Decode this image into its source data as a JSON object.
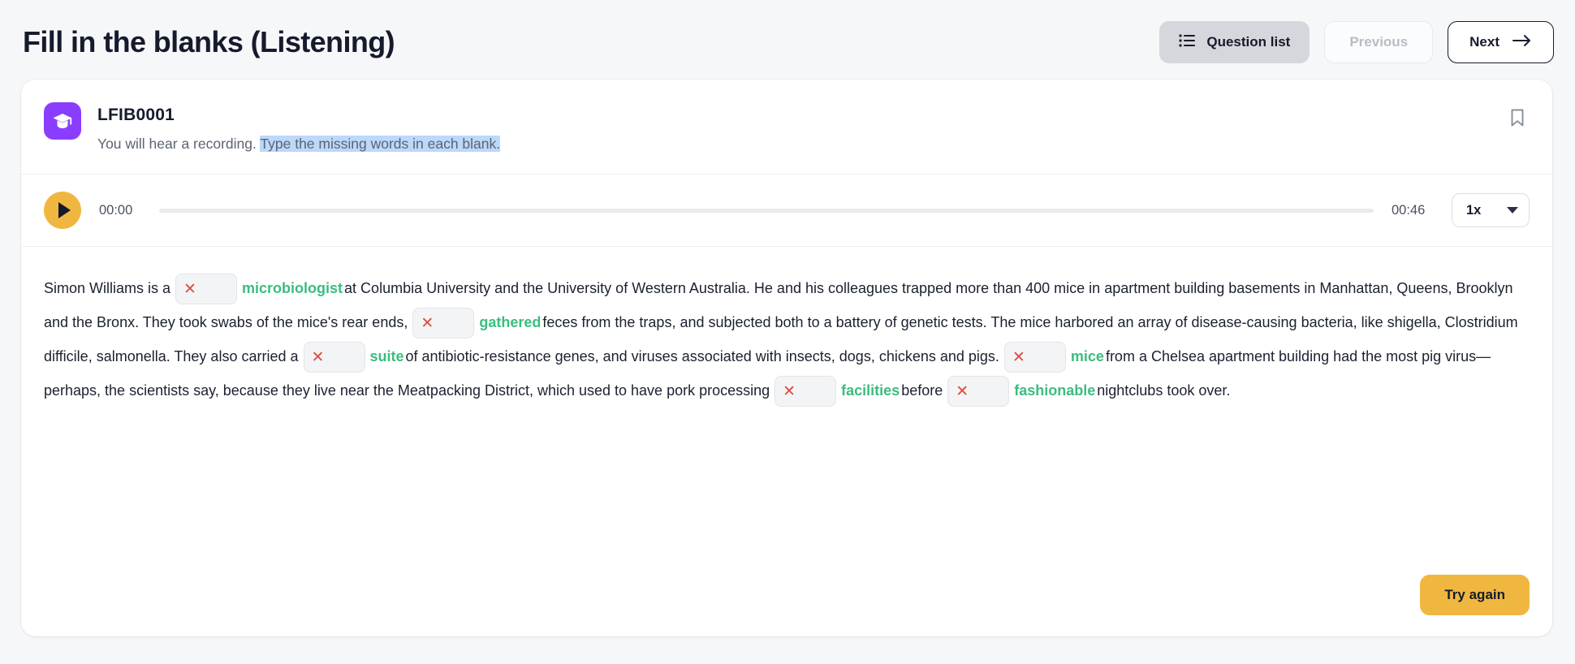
{
  "header": {
    "title": "Fill in the blanks (Listening)",
    "question_list_label": "Question list",
    "previous_label": "Previous",
    "next_label": "Next"
  },
  "question": {
    "code": "LFIB0001",
    "instruction_plain": "You will hear a recording.",
    "instruction_highlighted": "Type the missing words in each blank."
  },
  "player": {
    "current_time": "00:00",
    "duration": "00:46",
    "speed": "1x",
    "progress_percent": 0
  },
  "passage": {
    "s1": "Simon Williams is a",
    "a1": "microbiologist",
    "s2": "at Columbia University and the University of Western Australia. He and his colleagues trapped more than 400 mice in apartment building basements in Manhattan, Queens, Brooklyn and the Bronx. They took swabs of the mice's rear ends,",
    "a2": "gathered",
    "s3": "feces from the traps, and subjected both to a battery of genetic tests. The mice harbored an array of disease-causing bacteria, like shigella, Clostridium difficile, salmonella. They also carried a",
    "a3": "suite",
    "s4": "of antibiotic-resistance genes, and viruses associated with insects, dogs, chickens and pigs.",
    "a4": "mice",
    "s5": "from a Chelsea apartment building had the most pig virus—perhaps, the scientists say, because they live near the Meatpacking District, which used to have pork processing",
    "a5": "facilities",
    "s6": "before",
    "a6": "fashionable",
    "s7": "nightclubs took over.",
    "blank_mark": "✕"
  },
  "footer": {
    "try_again_label": "Try again"
  },
  "colors": {
    "accent_yellow": "#f0b740",
    "badge_purple": "#8b3dff",
    "correct_green": "#3bbd7e",
    "error_red": "#e04b3c",
    "selection_blue": "#bcd8fb"
  }
}
